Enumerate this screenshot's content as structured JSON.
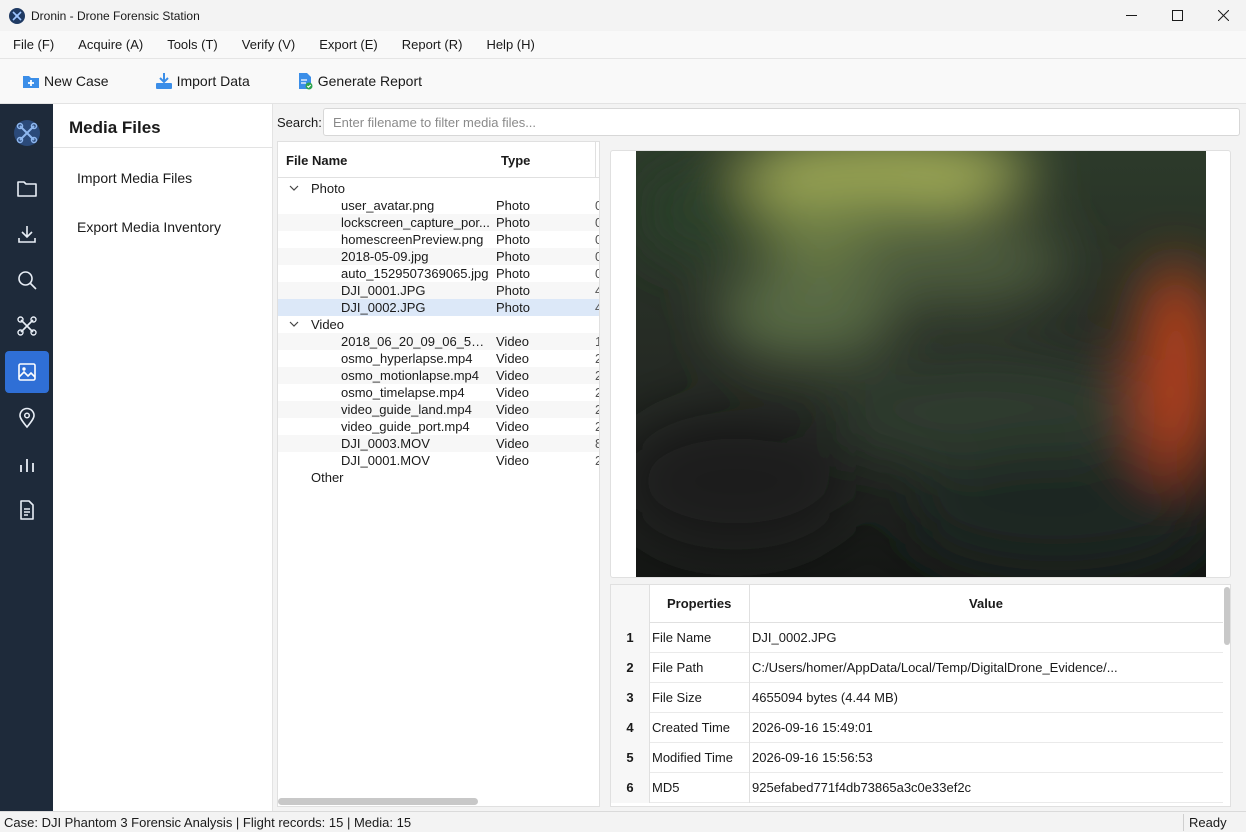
{
  "window": {
    "title": "Dronin - Drone Forensic Station",
    "app_icon": "drone-logo-icon",
    "controls": [
      "minimize-icon",
      "maximize-icon",
      "close-icon"
    ]
  },
  "menu": [
    {
      "label": "File (F)"
    },
    {
      "label": "Acquire (A)"
    },
    {
      "label": "Tools (T)"
    },
    {
      "label": "Verify (V)"
    },
    {
      "label": "Export (E)"
    },
    {
      "label": "Report (R)"
    },
    {
      "label": "Help (H)"
    }
  ],
  "toolbar": {
    "new_case": "New Case",
    "import_data": "Import Data",
    "generate_report": "Generate Report"
  },
  "nav_rail": {
    "items": [
      "drone-logo-icon",
      "folder-icon",
      "download-icon",
      "search-icon",
      "drone-icon",
      "image-icon",
      "location-pin-icon",
      "bar-chart-icon",
      "document-icon"
    ],
    "active": "image-icon",
    "active_color": "#2f6fd6"
  },
  "side_panel": {
    "title": "Media Files",
    "links": [
      "Import Media Files",
      "Export Media Inventory"
    ]
  },
  "search": {
    "label": "Search:",
    "placeholder": "Enter filename to filter media files...",
    "value": ""
  },
  "file_tree": {
    "columns": [
      "File Name",
      "Type"
    ],
    "categories": [
      {
        "label": "Photo",
        "expanded": true,
        "files": [
          {
            "name": "user_avatar.png",
            "type": "Photo",
            "extra": "0"
          },
          {
            "name": "lockscreen_capture_por...",
            "type": "Photo",
            "extra": "0"
          },
          {
            "name": "homescreenPreview.png",
            "type": "Photo",
            "extra": "0"
          },
          {
            "name": "2018-05-09.jpg",
            "type": "Photo",
            "extra": "0"
          },
          {
            "name": "auto_1529507369065.jpg",
            "type": "Photo",
            "extra": "0"
          },
          {
            "name": "DJI_0001.JPG",
            "type": "Photo",
            "extra": "4"
          },
          {
            "name": "DJI_0002.JPG",
            "type": "Photo",
            "extra": "4",
            "selected": true
          }
        ]
      },
      {
        "label": "Video",
        "expanded": true,
        "files": [
          {
            "name": "2018_06_20_09_06_58.m...",
            "type": "Video",
            "extra": "1"
          },
          {
            "name": "osmo_hyperlapse.mp4",
            "type": "Video",
            "extra": "2"
          },
          {
            "name": "osmo_motionlapse.mp4",
            "type": "Video",
            "extra": "2"
          },
          {
            "name": "osmo_timelapse.mp4",
            "type": "Video",
            "extra": "2"
          },
          {
            "name": "video_guide_land.mp4",
            "type": "Video",
            "extra": "2"
          },
          {
            "name": "video_guide_port.mp4",
            "type": "Video",
            "extra": "2"
          },
          {
            "name": "DJI_0003.MOV",
            "type": "Video",
            "extra": "8"
          },
          {
            "name": "DJI_0001.MOV",
            "type": "Video",
            "extra": "2"
          }
        ]
      },
      {
        "label": "Other",
        "expanded": false,
        "files": []
      }
    ]
  },
  "properties": {
    "columns": [
      "Properties",
      "Value"
    ],
    "rows": [
      {
        "index": "1",
        "name": "File Name",
        "value": "DJI_0002.JPG"
      },
      {
        "index": "2",
        "name": "File Path",
        "value": "C:/Users/homer/AppData/Local/Temp/DigitalDrone_Evidence/..."
      },
      {
        "index": "3",
        "name": "File Size",
        "value": "4655094 bytes (4.44 MB)"
      },
      {
        "index": "4",
        "name": "Created Time",
        "value": "2026-09-16 15:49:01"
      },
      {
        "index": "5",
        "name": "Modified Time",
        "value": "2026-09-16 15:56:53"
      },
      {
        "index": "6",
        "name": "MD5",
        "value": "925efabed771f4db73865a3c0e33ef2c"
      }
    ]
  },
  "status": {
    "left": "Case: DJI Phantom 3 Forensic Analysis | Flight records: 15 | Media: 15",
    "right": "Ready"
  }
}
